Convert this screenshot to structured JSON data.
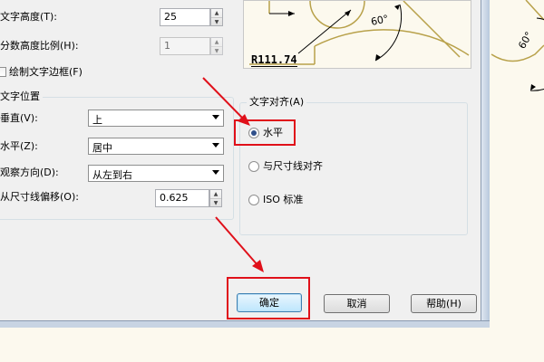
{
  "text_settings": {
    "text_height_label": "文字高度(T):",
    "text_height_value": "25",
    "fraction_scale_label": "分数高度比例(H):",
    "fraction_scale_value": "1",
    "draw_frame_label": "绘制文字边框(F)"
  },
  "text_placement": {
    "group_label": "文字位置",
    "vertical_label": "垂直(V):",
    "vertical_value": "上",
    "horizontal_label": "水平(Z):",
    "horizontal_value": "居中",
    "view_direction_label": "观察方向(D):",
    "view_direction_value": "从左到右",
    "offset_label": "从尺寸线偏移(O):",
    "offset_value": "0.625"
  },
  "text_alignment": {
    "group_label": "文字对齐(A)",
    "options": [
      "水平",
      "与尺寸线对齐",
      "ISO 标准"
    ],
    "selected": "水平"
  },
  "preview": {
    "radius_label": "R111.74",
    "angle_label": "60°",
    "angle_label_right": "60°"
  },
  "buttons": {
    "ok": "确定",
    "cancel": "取消",
    "help": "帮助(H)"
  },
  "colors": {
    "highlight": "#e0101a",
    "preview_bg": "#fcf9ee",
    "preview_stroke": "#b8a14a"
  }
}
